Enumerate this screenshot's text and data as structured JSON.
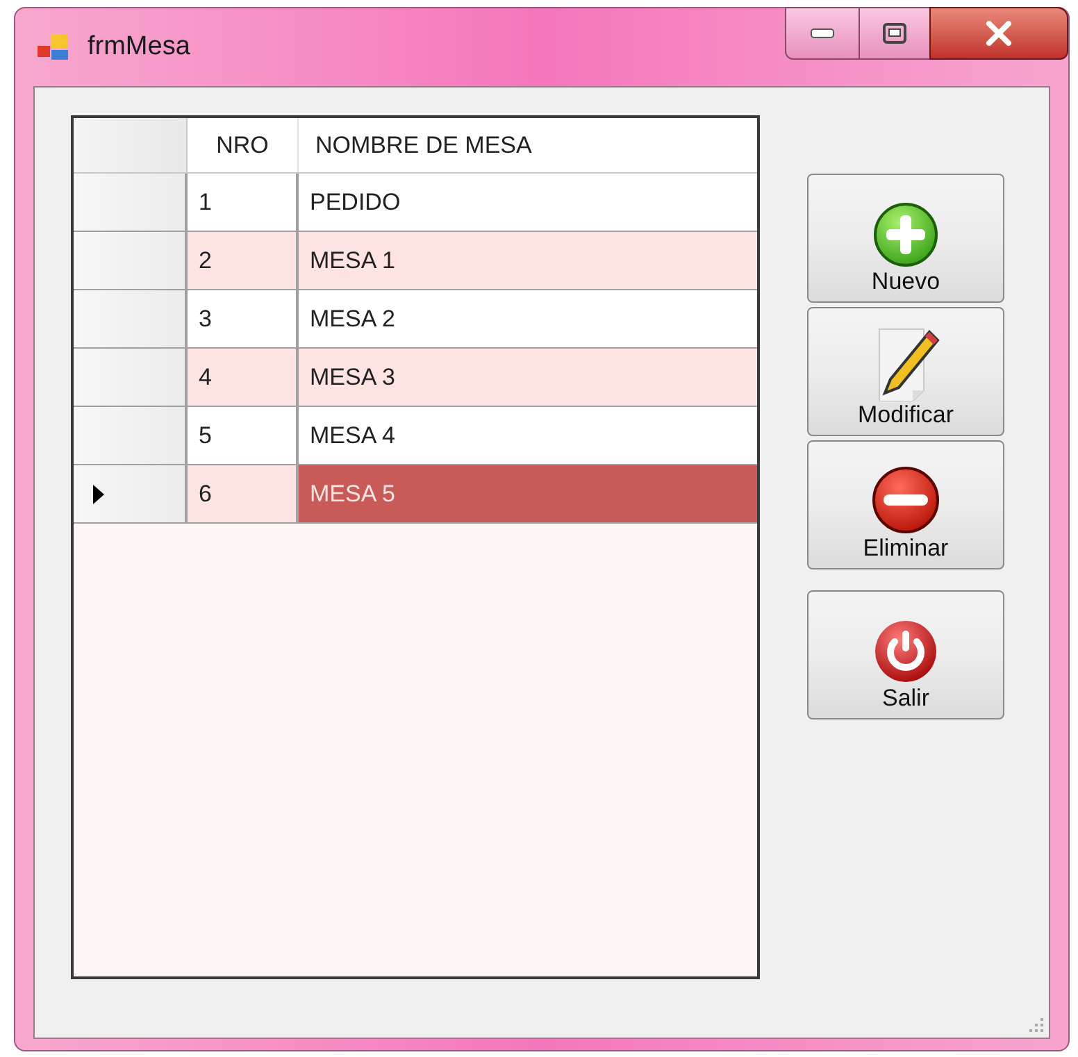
{
  "window": {
    "title": "frmMesa"
  },
  "table": {
    "columns": [
      "NRO",
      "NOMBRE DE MESA"
    ],
    "rows": [
      {
        "nro": "1",
        "name": "PEDIDO",
        "selected": false
      },
      {
        "nro": "2",
        "name": "MESA 1",
        "selected": false
      },
      {
        "nro": "3",
        "name": "MESA 2",
        "selected": false
      },
      {
        "nro": "4",
        "name": "MESA 3",
        "selected": false
      },
      {
        "nro": "5",
        "name": "MESA 4",
        "selected": false
      },
      {
        "nro": "6",
        "name": "MESA 5",
        "selected": true
      }
    ]
  },
  "buttons": [
    {
      "label": "Nuevo",
      "kind": "add"
    },
    {
      "label": "Modificar",
      "kind": "edit"
    },
    {
      "label": "Eliminar",
      "kind": "delete"
    },
    {
      "label": "Salir",
      "kind": "exit"
    }
  ]
}
